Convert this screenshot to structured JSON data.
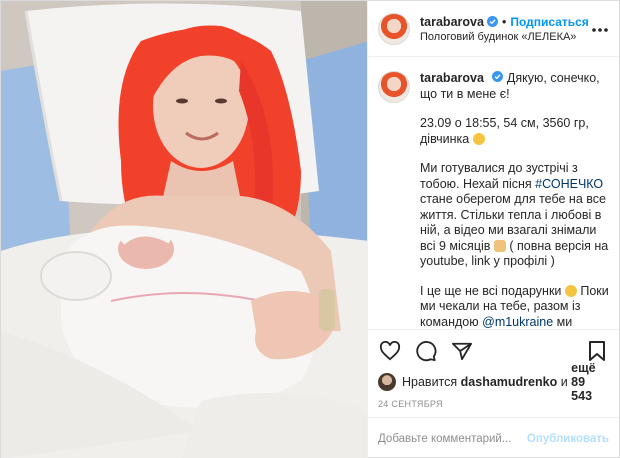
{
  "header": {
    "username": "tarabarova",
    "separator": "•",
    "follow_label": "Подписаться",
    "location": "Пологовий будинок «ЛЕЛЕКА»",
    "more_icon": "more-horizontal-icon"
  },
  "caption": {
    "username": "tarabarova",
    "line1": "Дякую, сонечко, що ти в мене є!",
    "p2": "23.09 о 18:55, 54 см, 3560 гр, дівчинка",
    "p3_a": "Ми готувалися до зустрічі з тобою. Нехай пісня",
    "p3_tag": "#СОНЕЧКО",
    "p3_b": "стане оберегом для тебе на все життя. Стільки тепла і любові в ній, а відео ми взагалі знімали всі 9 місяців",
    "p3_c": "( повна версія на youtube, link у профілі )",
    "p4_a": "І це ще не всі подарунки",
    "p4_b": "Поки ми чекали на тебе, разом із командою",
    "p4_mention": "@m1ukraine",
    "p4_c": "ми знімали справжнє реаліті, яке вже незабаром побачить вся країна!"
  },
  "likes": {
    "prefix": "Нравится",
    "user": "dashamudrenko",
    "middle": "и",
    "others": "ещё 89 543"
  },
  "date": "24 СЕНТЯБРЯ",
  "comment": {
    "placeholder": "Добавьте комментарий...",
    "publish_label": "Опубликовать"
  },
  "colors": {
    "accent": "#0095f6",
    "hair": "#f2412a",
    "text": "#262626",
    "muted": "#8e8e8e"
  }
}
